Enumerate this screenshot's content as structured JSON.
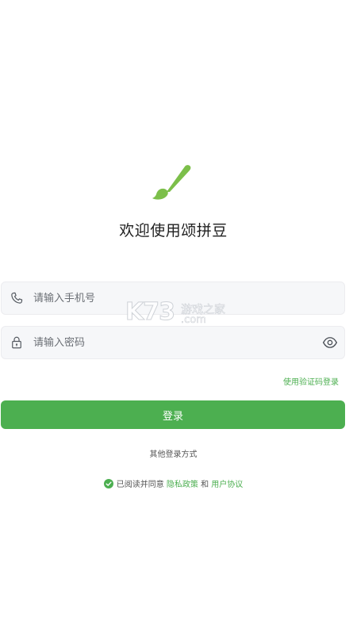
{
  "logo": {
    "icon": "paintbrush-icon",
    "color": "#7cbf4a"
  },
  "welcome_title": "欢迎使用颂拼豆",
  "phone_field": {
    "icon": "phone-icon",
    "placeholder": "请输入手机号",
    "value": ""
  },
  "password_field": {
    "icon": "lock-icon",
    "placeholder": "请输入密码",
    "value": "",
    "toggle_icon": "eye-icon"
  },
  "code_login_label": "使用验证码登录",
  "login_button_label": "登录",
  "other_login_label": "其他登录方式",
  "agreement": {
    "checked": true,
    "check_icon": "check-circle-icon",
    "prefix": "已阅读并同意",
    "privacy_link": "隐私政策",
    "and": "和",
    "terms_link": "用户协议"
  },
  "watermark": {
    "big": "K73",
    "cn": "游戏之家",
    "com": ".com"
  },
  "colors": {
    "accent": "#4caf50",
    "input_bg": "#f6f7f9"
  }
}
